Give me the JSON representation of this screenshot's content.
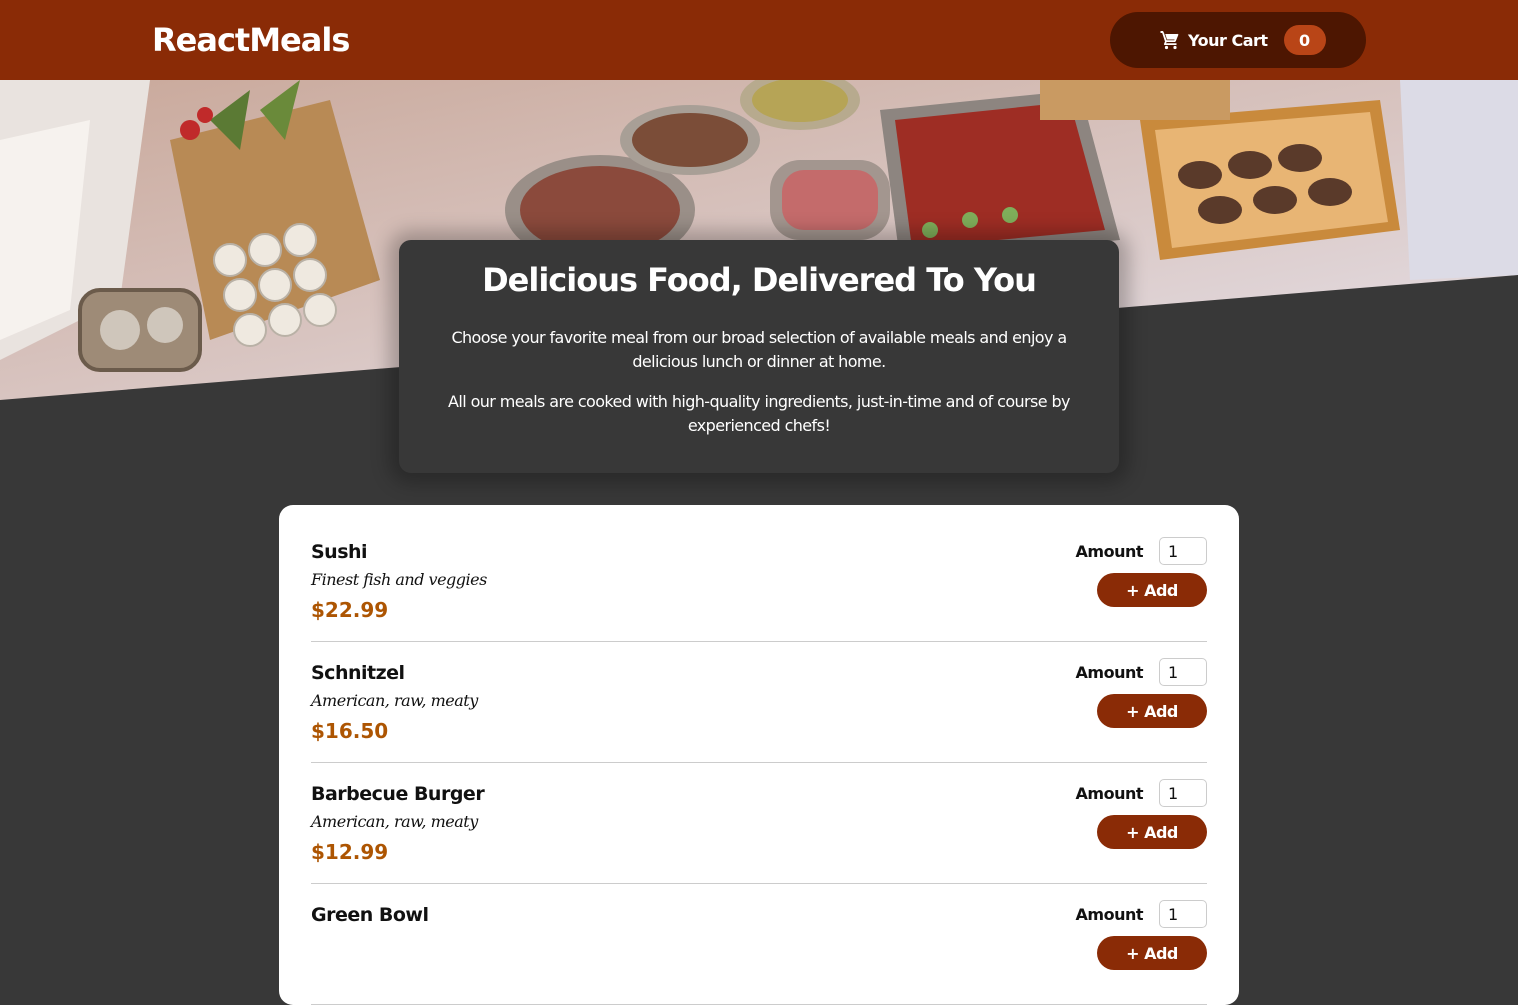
{
  "header": {
    "brand": "ReactMeals",
    "cart": {
      "label": "Your Cart",
      "count": "0",
      "icon": "cart-icon"
    }
  },
  "hero": {
    "image": "buffet-table-photo"
  },
  "summary": {
    "title": "Delicious Food, Delivered To You",
    "paragraph1": "Choose your favorite meal from our broad selection of available meals and enjoy a delicious lunch or dinner at home.",
    "paragraph2": "All our meals are cooked with high-quality ingredients, just-in-time and of course by experienced chefs!"
  },
  "meals": [
    {
      "name": "Sushi",
      "description": "Finest fish and veggies",
      "price": "$22.99",
      "amount_label": "Amount",
      "amount_value": "1",
      "add_label": "+ Add"
    },
    {
      "name": "Schnitzel",
      "description": "American, raw, meaty",
      "price": "$16.50",
      "amount_label": "Amount",
      "amount_value": "1",
      "add_label": "+ Add"
    },
    {
      "name": "Barbecue Burger",
      "description": "American, raw, meaty",
      "price": "$12.99",
      "amount_label": "Amount",
      "amount_value": "1",
      "add_label": "+ Add"
    },
    {
      "name": "Green Bowl",
      "description": "",
      "price": "",
      "amount_label": "Amount",
      "amount_value": "1",
      "add_label": "+ Add"
    }
  ],
  "colors": {
    "header": "#8a2b06",
    "cart_button": "#4d1601",
    "badge": "#b94517",
    "background": "#383838",
    "price": "#ad5502"
  }
}
